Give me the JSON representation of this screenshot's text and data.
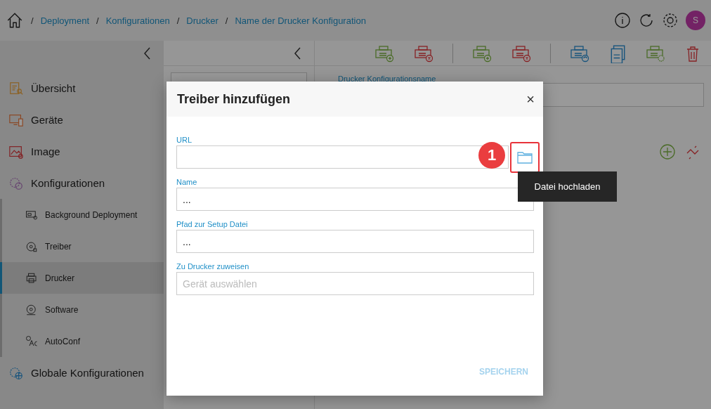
{
  "breadcrumb": [
    "Deployment",
    "Konfigurationen",
    "Drucker",
    "Name der Drucker Konfiguration"
  ],
  "breadcrumb_separator": "/",
  "user": {
    "initial": "S"
  },
  "sidebar": {
    "items": [
      {
        "kind": "section",
        "label": "Übersicht",
        "selected": false
      },
      {
        "kind": "section",
        "label": "Geräte",
        "selected": false
      },
      {
        "kind": "section",
        "label": "Image",
        "selected": false
      },
      {
        "kind": "section",
        "label": "Konfigurationen",
        "selected": false,
        "children": [
          {
            "label": "Background Deployment",
            "selected": false
          },
          {
            "label": "Treiber",
            "selected": false
          },
          {
            "label": "Drucker",
            "selected": true
          },
          {
            "label": "Software",
            "selected": false
          },
          {
            "label": "AutoConf",
            "selected": false
          }
        ]
      },
      {
        "kind": "section",
        "label": "Globale Konfigurationen",
        "selected": false
      }
    ]
  },
  "detail": {
    "field_label": "Drucker Konfigurationsname"
  },
  "dialog": {
    "title": "Treiber hinzufügen",
    "close": "×",
    "fields": [
      {
        "label": "URL",
        "kind": "upload"
      },
      {
        "label": "Name",
        "kind": "text",
        "value": "..."
      },
      {
        "label": "Pfad zur Setup Datei",
        "kind": "text",
        "value": "..."
      },
      {
        "label": "Zu Drucker zuweisen",
        "kind": "select",
        "placeholder": "Gerät auswählen"
      }
    ],
    "save": {
      "label": "SPEICHERN",
      "disabled": true
    }
  },
  "callout": {
    "number": "1"
  },
  "tooltip": "Datei hochladen"
}
